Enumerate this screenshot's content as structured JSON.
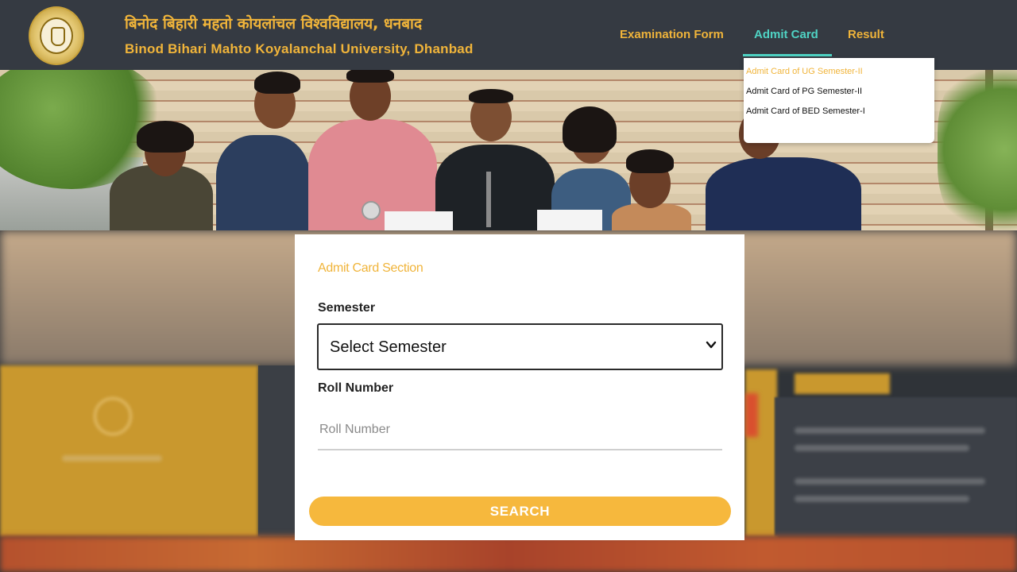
{
  "header": {
    "title_hindi": "बिनोद बिहारी महतो कोयलांचल विश्वविद्यालय, धनबाद",
    "title_english": "Binod Bihari Mahto Koyalanchal University, Dhanbad",
    "nav": [
      {
        "label": "Examination Form"
      },
      {
        "label": "Admit Card"
      },
      {
        "label": "Result"
      }
    ],
    "active_nav": "Admit Card"
  },
  "dropdown": {
    "items": [
      {
        "label": "Admit Card of UG Semester-II",
        "highlighted": true
      },
      {
        "label": "Admit Card of PG Semester-II",
        "highlighted": false
      },
      {
        "label": "Admit Card of BED Semester-I",
        "highlighted": false
      }
    ]
  },
  "form": {
    "section_title": "Admit Card Section",
    "semester_label": "Semester",
    "semester_selected": "Select Semester",
    "roll_label": "Roll Number",
    "roll_placeholder": "Roll Number",
    "roll_value": "",
    "search_label": "SEARCH"
  },
  "colors": {
    "header_bg": "#353a42",
    "accent_gold": "#f0b43a",
    "accent_teal": "#4fd3c4",
    "button": "#f6b83d"
  },
  "icons": {
    "logo": "university-seal-icon",
    "select_arrow": "chevron-down-icon"
  }
}
